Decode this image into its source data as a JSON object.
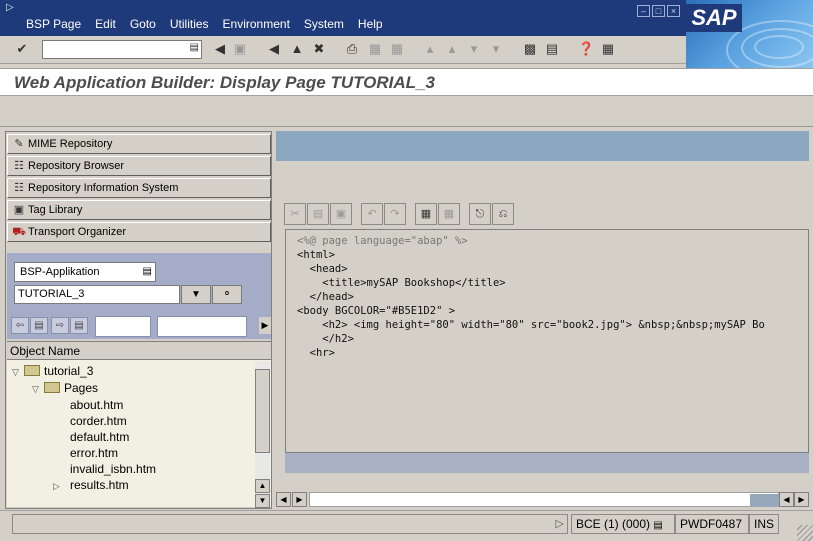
{
  "menu": [
    "BSP Page",
    "Edit",
    "Goto",
    "Utilities",
    "Environment",
    "System",
    "Help"
  ],
  "brand": "SAP",
  "window_controls": [
    "minimize-icon",
    "maximize-icon",
    "close-icon"
  ],
  "screen_title": "Web Application Builder: Display Page TUTORIAL_3",
  "navigation": {
    "buttons": [
      "MIME Repository",
      "Repository Browser",
      "Repository Information System",
      "Tag Library",
      "Transport Organizer"
    ],
    "object_type": "BSP-Applikation",
    "object_name": "TUTORIAL_3"
  },
  "tree": {
    "header": "Object Name",
    "root": "tutorial_3",
    "folder": "Pages",
    "pages": [
      "about.htm",
      "corder.htm",
      "default.htm",
      "error.htm",
      "invalid_isbn.htm",
      "results.htm"
    ]
  },
  "editor": {
    "code_lines": [
      "<%@ page language=\"abap\" %>",
      "<html>",
      "  <head>",
      "    <title>mySAP Bookshop</title>",
      "  </head>",
      "<body BGCOLOR=\"#B5E1D2\" >",
      "    <h2> <img height=\"80\" width=\"80\" src=\"book2.jpg\"> &nbsp;&nbsp;mySAP Bo",
      "    </h2>",
      "  <hr>"
    ]
  },
  "status": {
    "system": "BCE (1) (000)",
    "server": "PWDF0487",
    "mode": "INS"
  },
  "colors": {
    "menubar": "#1f3a7a",
    "nav_area": "#a4acc8",
    "editor_band": "#8ca8c0",
    "background": "#d4d0c8"
  }
}
